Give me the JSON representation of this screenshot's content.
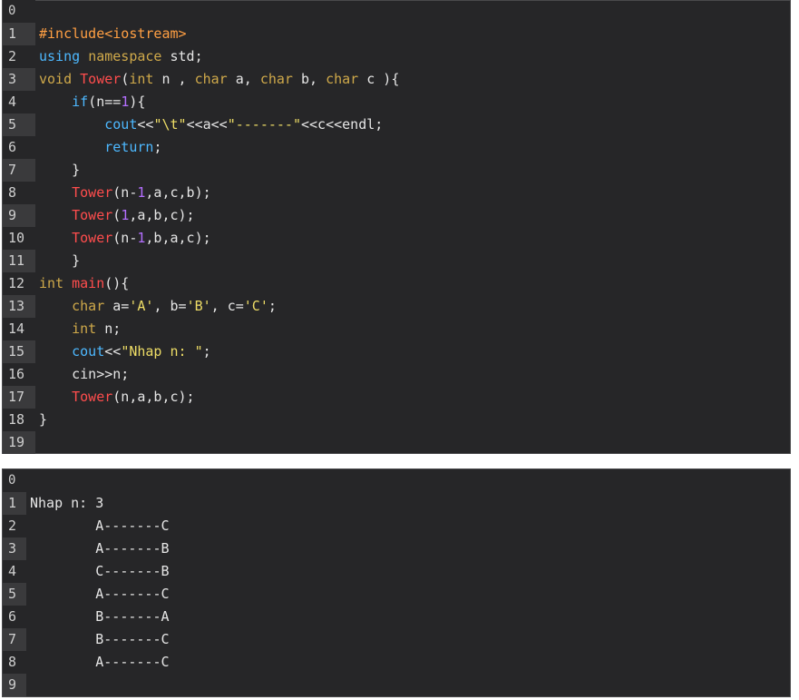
{
  "code_panel": {
    "lines": [
      {
        "n": "0",
        "tokens": []
      },
      {
        "n": "1",
        "tokens": [
          {
            "t": "#include<iostream>",
            "c": "t-inc"
          }
        ]
      },
      {
        "n": "2",
        "tokens": [
          {
            "t": "using",
            "c": "t-blue"
          },
          {
            "t": " ",
            "c": "t-plain"
          },
          {
            "t": "namespace",
            "c": "t-kw"
          },
          {
            "t": " std;",
            "c": "t-plain"
          }
        ]
      },
      {
        "n": "3",
        "tokens": [
          {
            "t": "void",
            "c": "t-type"
          },
          {
            "t": " ",
            "c": "t-plain"
          },
          {
            "t": "Tower",
            "c": "t-fn"
          },
          {
            "t": "(",
            "c": "t-plain"
          },
          {
            "t": "int",
            "c": "t-type"
          },
          {
            "t": " n , ",
            "c": "t-plain"
          },
          {
            "t": "char",
            "c": "t-type"
          },
          {
            "t": " a, ",
            "c": "t-plain"
          },
          {
            "t": "char",
            "c": "t-type"
          },
          {
            "t": " b, ",
            "c": "t-plain"
          },
          {
            "t": "char",
            "c": "t-type"
          },
          {
            "t": " c ){",
            "c": "t-plain"
          }
        ]
      },
      {
        "n": "4",
        "tokens": [
          {
            "t": "    ",
            "c": "t-plain"
          },
          {
            "t": "if",
            "c": "t-blue"
          },
          {
            "t": "(n==",
            "c": "t-plain"
          },
          {
            "t": "1",
            "c": "t-num"
          },
          {
            "t": "){",
            "c": "t-plain"
          }
        ]
      },
      {
        "n": "5",
        "tokens": [
          {
            "t": "        ",
            "c": "t-plain"
          },
          {
            "t": "cout",
            "c": "t-obj"
          },
          {
            "t": "<<",
            "c": "t-plain"
          },
          {
            "t": "\"\\t\"",
            "c": "t-str"
          },
          {
            "t": "<<a<<",
            "c": "t-plain"
          },
          {
            "t": "\"-------\"",
            "c": "t-str"
          },
          {
            "t": "<<c<<endl;",
            "c": "t-plain"
          }
        ]
      },
      {
        "n": "6",
        "tokens": [
          {
            "t": "        ",
            "c": "t-plain"
          },
          {
            "t": "return",
            "c": "t-blue"
          },
          {
            "t": ";",
            "c": "t-plain"
          }
        ]
      },
      {
        "n": "7",
        "tokens": [
          {
            "t": "    }",
            "c": "t-plain"
          }
        ]
      },
      {
        "n": "8",
        "tokens": [
          {
            "t": "    ",
            "c": "t-plain"
          },
          {
            "t": "Tower",
            "c": "t-fn"
          },
          {
            "t": "(n-",
            "c": "t-plain"
          },
          {
            "t": "1",
            "c": "t-num"
          },
          {
            "t": ",a,c,b);",
            "c": "t-plain"
          }
        ]
      },
      {
        "n": "9",
        "tokens": [
          {
            "t": "    ",
            "c": "t-plain"
          },
          {
            "t": "Tower",
            "c": "t-fn"
          },
          {
            "t": "(",
            "c": "t-plain"
          },
          {
            "t": "1",
            "c": "t-num"
          },
          {
            "t": ",a,b,c);",
            "c": "t-plain"
          }
        ]
      },
      {
        "n": "10",
        "tokens": [
          {
            "t": "    ",
            "c": "t-plain"
          },
          {
            "t": "Tower",
            "c": "t-fn"
          },
          {
            "t": "(n-",
            "c": "t-plain"
          },
          {
            "t": "1",
            "c": "t-num"
          },
          {
            "t": ",b,a,c);",
            "c": "t-plain"
          }
        ]
      },
      {
        "n": "11",
        "tokens": [
          {
            "t": "    }",
            "c": "t-plain"
          }
        ]
      },
      {
        "n": "12",
        "tokens": [
          {
            "t": "int",
            "c": "t-type"
          },
          {
            "t": " ",
            "c": "t-plain"
          },
          {
            "t": "main",
            "c": "t-fn"
          },
          {
            "t": "(){",
            "c": "t-plain"
          }
        ]
      },
      {
        "n": "13",
        "tokens": [
          {
            "t": "    ",
            "c": "t-plain"
          },
          {
            "t": "char",
            "c": "t-type"
          },
          {
            "t": " a=",
            "c": "t-plain"
          },
          {
            "t": "'A'",
            "c": "t-str"
          },
          {
            "t": ", b=",
            "c": "t-plain"
          },
          {
            "t": "'B'",
            "c": "t-str"
          },
          {
            "t": ", c=",
            "c": "t-plain"
          },
          {
            "t": "'C'",
            "c": "t-str"
          },
          {
            "t": ";",
            "c": "t-plain"
          }
        ]
      },
      {
        "n": "14",
        "tokens": [
          {
            "t": "    ",
            "c": "t-plain"
          },
          {
            "t": "int",
            "c": "t-type"
          },
          {
            "t": " n;",
            "c": "t-plain"
          }
        ]
      },
      {
        "n": "15",
        "tokens": [
          {
            "t": "    ",
            "c": "t-plain"
          },
          {
            "t": "cout",
            "c": "t-obj"
          },
          {
            "t": "<<",
            "c": "t-plain"
          },
          {
            "t": "\"Nhap n: \"",
            "c": "t-str"
          },
          {
            "t": ";",
            "c": "t-plain"
          }
        ]
      },
      {
        "n": "16",
        "tokens": [
          {
            "t": "    cin>>n;",
            "c": "t-plain"
          }
        ]
      },
      {
        "n": "17",
        "tokens": [
          {
            "t": "    ",
            "c": "t-plain"
          },
          {
            "t": "Tower",
            "c": "t-fn"
          },
          {
            "t": "(n,a,b,c);",
            "c": "t-plain"
          }
        ]
      },
      {
        "n": "18",
        "tokens": [
          {
            "t": "}",
            "c": "t-plain"
          }
        ]
      },
      {
        "n": "19",
        "tokens": []
      }
    ]
  },
  "output_panel": {
    "lines": [
      {
        "n": "0",
        "text": ""
      },
      {
        "n": "1",
        "text": "Nhap n: 3"
      },
      {
        "n": "2",
        "text": "        A-------C"
      },
      {
        "n": "3",
        "text": "        A-------B"
      },
      {
        "n": "4",
        "text": "        C-------B"
      },
      {
        "n": "5",
        "text": "        A-------C"
      },
      {
        "n": "6",
        "text": "        B-------A"
      },
      {
        "n": "7",
        "text": "        B-------C"
      },
      {
        "n": "8",
        "text": "        A-------C"
      },
      {
        "n": "9",
        "text": ""
      }
    ]
  },
  "colors": {
    "background": "#262628",
    "gutter_alt": "#3a3a3c",
    "text": "#e6e6e6"
  }
}
